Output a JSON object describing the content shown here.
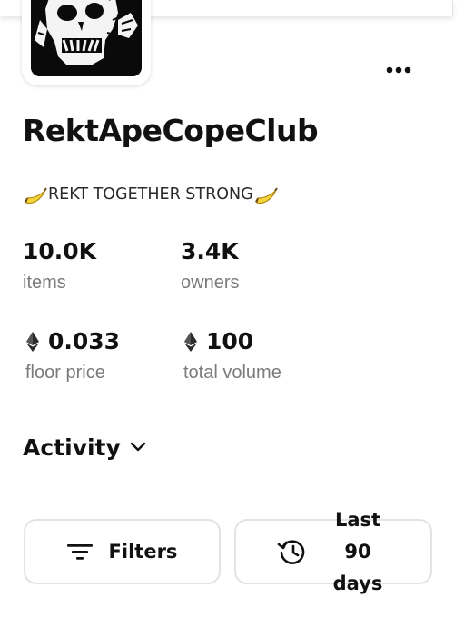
{
  "collection": {
    "name": "RektApeCopeClub",
    "tagline": "REKT TOGETHER STRONG"
  },
  "stats": {
    "items_value": "10.0K",
    "items_label": "items",
    "owners_value": "3.4K",
    "owners_label": "owners",
    "floor_value": "0.033",
    "floor_label": "floor price",
    "volume_value": "100",
    "volume_label": "total volume"
  },
  "activity": {
    "label": "Activity"
  },
  "controls": {
    "filters_label": "Filters",
    "days_line1": "Last",
    "days_line2": "90",
    "days_line3": "days"
  },
  "icons": {
    "more": "more-horizontal-icon",
    "eth": "ethereum-icon",
    "chevron": "chevron-down-icon",
    "filters": "filter-lines-icon",
    "history": "history-icon",
    "banana": "banana-emoji"
  },
  "colors": {
    "text": "#111111",
    "muted": "#7b7b7b",
    "border": "#e3e3e3"
  }
}
